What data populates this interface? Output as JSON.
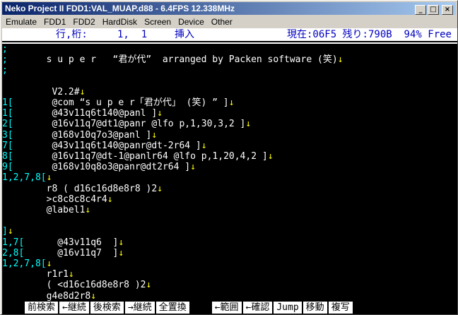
{
  "window": {
    "title": "Neko Project II  FDD1:VAL_MUAP.d88 - 6.4FPS 12.338MHz",
    "min_btn": "_",
    "max_btn": "□",
    "close_btn": "×"
  },
  "menu": [
    "Emulate",
    "FDD1",
    "FDD2",
    "HardDisk",
    "Screen",
    "Device",
    "Other"
  ],
  "status": {
    "position_label": "行,桁:     1,  1",
    "insert_label": "挿入",
    "info": "現在:06F5 残り:790B  94% Free"
  },
  "lines": [
    {
      "mark": ";",
      "text": ""
    },
    {
      "mark": ";",
      "text": "       s u p e r   “君が代”  arranged by Packen software (笑)↓"
    },
    {
      "mark": ";",
      "text": ""
    },
    {
      "mark": "",
      "text": ""
    },
    {
      "mark": "",
      "text": "         V2.2#↓"
    },
    {
      "mark": "1[",
      "text": "       @com “s u p e r「君が代」 (笑) ” ]↓"
    },
    {
      "mark": "1[",
      "text": "       @43v11q6t140@panl ]↓"
    },
    {
      "mark": "2[",
      "text": "       @16v11q7@dt1@panr @lfo p,1,30,3,2 ]↓"
    },
    {
      "mark": "3[",
      "text": "       @168v10q7o3@panl ]↓"
    },
    {
      "mark": "7[",
      "text": "       @43v11q6t140@panr@dt-2r64 ]↓"
    },
    {
      "mark": "8[",
      "text": "       @16v11q7@dt-1@panlr64 @lfo p,1,20,4,2 ]↓"
    },
    {
      "mark": "9[",
      "text": "       @168v10q8o3@panr@dt2r64 ]↓"
    },
    {
      "mark": "1,2,7,8[",
      "text": "↓"
    },
    {
      "mark": "",
      "text": "        r8 ( d16c16d8e8r8 )2↓"
    },
    {
      "mark": "",
      "text": "        >c8c8c8c4r4↓"
    },
    {
      "mark": "",
      "text": "        @label1↓"
    },
    {
      "mark": "",
      "text": ""
    },
    {
      "mark": "]",
      "text": "↓"
    },
    {
      "mark": "1,7[",
      "text": "      @43v11q6  ]↓"
    },
    {
      "mark": "2,8[",
      "text": "      @16v11q7  ]↓"
    },
    {
      "mark": "1,2,7,8[",
      "text": "↓"
    },
    {
      "mark": "",
      "text": "        r1r1↓"
    },
    {
      "mark": "",
      "text": "        ( <d16c16d8e8r8 )2↓"
    },
    {
      "mark": "",
      "text": "        g4e8d2r8↓"
    }
  ],
  "fkeys": [
    "前検索",
    "←継続",
    "後検索",
    "→継続",
    "全置換",
    "←範囲",
    "←確認",
    "Jump",
    "移動",
    "複写"
  ]
}
